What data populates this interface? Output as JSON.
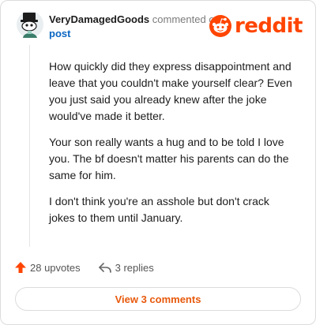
{
  "comment": {
    "username": "VeryDamagedGoods",
    "action_text": "commented on",
    "target_link": "post",
    "paragraphs": [
      "How quickly did they express disappointment and leave that you couldn't make yourself clear? Even you just said you already knew after the joke would've made it better.",
      "Your son really wants a hug and to be told I love you. The bf doesn't matter his parents can do the same for him.",
      "I don't think you're an asshole but don't crack jokes to them until January."
    ]
  },
  "brand": {
    "name": "reddit",
    "color": "#ff4500",
    "icon": "reddit-alien-icon"
  },
  "actions": {
    "upvotes_label": "28 upvotes",
    "upvote_icon": "upvote-arrow-icon",
    "upvote_color": "#ff4500",
    "replies_label": "3 replies",
    "reply_icon": "reply-arrow-icon"
  },
  "view_comments_label": "View 3 comments"
}
